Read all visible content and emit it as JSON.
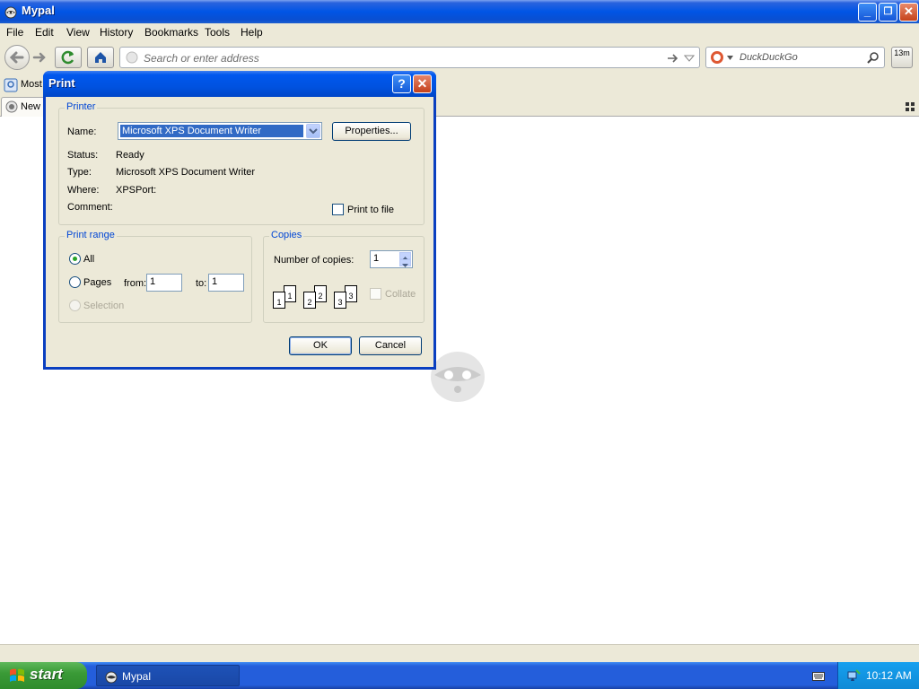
{
  "window": {
    "title": "Mypal",
    "minimize": "_",
    "restore": "❐",
    "close": "✕"
  },
  "menu": [
    "File",
    "Edit",
    "View",
    "History",
    "Bookmarks",
    "Tools",
    "Help"
  ],
  "navbar": {
    "address_placeholder": "Search or enter address",
    "search_placeholder": "DuckDuckGo",
    "badge": "13m"
  },
  "bookmarks": {
    "most_visited": "Most"
  },
  "tab": {
    "label": "New T"
  },
  "dialog": {
    "title": "Print",
    "help": "?",
    "close": "✕",
    "printer": {
      "legend": "Printer",
      "name_label": "Name:",
      "name_value": "Microsoft XPS Document Writer",
      "properties": "Properties...",
      "status_label": "Status:",
      "status_value": "Ready",
      "type_label": "Type:",
      "type_value": "Microsoft XPS Document Writer",
      "where_label": "Where:",
      "where_value": "XPSPort:",
      "comment_label": "Comment:",
      "print_to_file": "Print to file"
    },
    "range": {
      "legend": "Print range",
      "all": "All",
      "pages": "Pages",
      "from_label": "from:",
      "from_value": "1",
      "to_label": "to:",
      "to_value": "1",
      "selection": "Selection"
    },
    "copies": {
      "legend": "Copies",
      "number_label": "Number of copies:",
      "number_value": "1",
      "collate": "Collate",
      "pages": [
        "1",
        "1",
        "2",
        "2",
        "3",
        "3"
      ]
    },
    "ok": "OK",
    "cancel": "Cancel"
  },
  "taskbar": {
    "start": "start",
    "task": "Mypal",
    "clock": "10:12 AM"
  },
  "colors": {
    "titlebar": "#0055e5",
    "dialog_border": "#0a3fc0",
    "taskbar": "#245edb",
    "start": "#3a9a37",
    "legend": "#0046d5"
  }
}
